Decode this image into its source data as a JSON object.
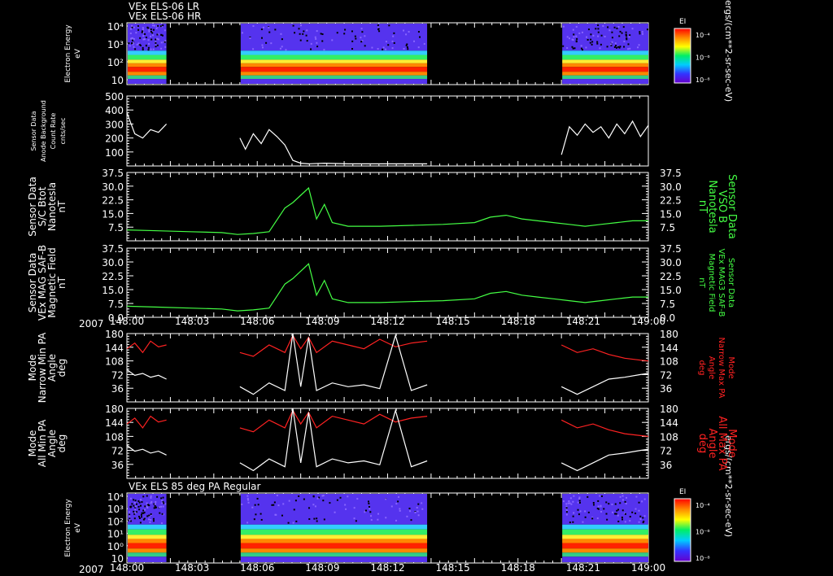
{
  "chart_data": [
    {
      "type": "heatmap",
      "id": "spec1",
      "header_lines": [
        "VEx ELS-06 LR",
        "VEx ELS-06 HR"
      ],
      "ylabel": [
        "Electron Energy",
        "eV"
      ],
      "yticks": [
        "10",
        "10²",
        "10³",
        "10⁴"
      ],
      "colorbar": {
        "label": "EI",
        "ticks": [
          "10⁻⁴",
          "10⁻⁶",
          "10⁻⁸"
        ],
        "units": "ergs/(cm**2-sr-sec-eV)"
      }
    },
    {
      "type": "line",
      "id": "count",
      "ylabel": [
        "Sensor Data",
        "Anode Background",
        "Count Rate",
        "cnts/sec"
      ],
      "yticks": [
        100,
        200,
        300,
        400,
        500
      ],
      "ylim": [
        0,
        500
      ],
      "series": [
        {
          "color": "#ffffff",
          "segments": [
            [
              [
                148.0,
                380
              ],
              [
                148.05,
                230
              ],
              [
                148.1,
                200
              ],
              [
                148.15,
                260
              ],
              [
                148.2,
                240
              ],
              [
                148.25,
                300
              ]
            ],
            [
              [
                148.715,
                200
              ],
              [
                148.75,
                120
              ],
              [
                148.8,
                230
              ],
              [
                148.85,
                160
              ],
              [
                148.9,
                260
              ],
              [
                148.95,
                210
              ],
              [
                149.0,
                150
              ],
              [
                149.05,
                40
              ],
              [
                149.1,
                20
              ],
              [
                149.15,
                15
              ],
              [
                149.25,
                20
              ],
              [
                149.4,
                15
              ],
              [
                149.6,
                15
              ],
              [
                149.8,
                15
              ],
              [
                149.9,
                15
              ]
            ],
            [
              [
                150.75,
                80
              ],
              [
                150.8,
                280
              ],
              [
                150.85,
                220
              ],
              [
                150.9,
                300
              ],
              [
                150.95,
                240
              ],
              [
                151.0,
                280
              ],
              [
                151.05,
                200
              ],
              [
                151.1,
                300
              ],
              [
                151.15,
                230
              ],
              [
                151.2,
                320
              ],
              [
                151.25,
                210
              ],
              [
                151.3,
                290
              ]
            ]
          ]
        }
      ]
    },
    {
      "type": "line",
      "id": "bt",
      "ylabel": [
        "Sensor Data",
        "S/C Btot",
        "Nanotesla",
        "nT"
      ],
      "rlabel": [
        "Sensor Data",
        "VSO B",
        "Nanotesla",
        "nT"
      ],
      "yticks": [
        7.5,
        15.0,
        22.5,
        30.0,
        37.5
      ],
      "ylim": [
        0,
        37.5
      ],
      "series": [
        {
          "color": "#44ff44",
          "points": [
            [
              148.0,
              6
            ],
            [
              148.2,
              5.5
            ],
            [
              148.4,
              5
            ],
            [
              148.6,
              4.5
            ],
            [
              148.7,
              3.5
            ],
            [
              148.8,
              4
            ],
            [
              148.9,
              5
            ],
            [
              149.0,
              18
            ],
            [
              149.05,
              21
            ],
            [
              149.1,
              25
            ],
            [
              149.15,
              29
            ],
            [
              149.2,
              12
            ],
            [
              149.25,
              20
            ],
            [
              149.3,
              10
            ],
            [
              149.4,
              8
            ],
            [
              149.6,
              8
            ],
            [
              149.8,
              8.5
            ],
            [
              150.0,
              9
            ],
            [
              150.2,
              10
            ],
            [
              150.3,
              13
            ],
            [
              150.4,
              14
            ],
            [
              150.5,
              12
            ],
            [
              150.6,
              11
            ],
            [
              150.7,
              10
            ],
            [
              150.8,
              9
            ],
            [
              150.9,
              8
            ],
            [
              151.0,
              9
            ],
            [
              151.1,
              10
            ],
            [
              151.2,
              11
            ],
            [
              151.3,
              11
            ]
          ]
        }
      ]
    },
    {
      "type": "line",
      "id": "bsaf",
      "ylabel": [
        "Sensor Data",
        "VEx MAG SAF-B",
        "Magnetic Field",
        "nT"
      ],
      "rlabel": [
        "Sensor Data",
        "VEx MAG3 SAF-B",
        "Magnetic Field",
        "nT"
      ],
      "yticks": [
        0.0,
        7.5,
        15.0,
        22.5,
        30.0,
        37.5
      ],
      "ylim": [
        0,
        37.5
      ],
      "series": [
        {
          "color": "#44ff44",
          "points": [
            [
              148.0,
              6
            ],
            [
              148.2,
              5.5
            ],
            [
              148.4,
              5
            ],
            [
              148.6,
              4.5
            ],
            [
              148.7,
              3.5
            ],
            [
              148.8,
              4
            ],
            [
              148.9,
              5
            ],
            [
              149.0,
              18
            ],
            [
              149.05,
              21
            ],
            [
              149.1,
              25
            ],
            [
              149.15,
              29
            ],
            [
              149.2,
              12
            ],
            [
              149.25,
              20
            ],
            [
              149.3,
              10
            ],
            [
              149.4,
              8
            ],
            [
              149.6,
              8
            ],
            [
              149.8,
              8.5
            ],
            [
              150.0,
              9
            ],
            [
              150.2,
              10
            ],
            [
              150.3,
              13
            ],
            [
              150.4,
              14
            ],
            [
              150.5,
              12
            ],
            [
              150.6,
              11
            ],
            [
              150.7,
              10
            ],
            [
              150.8,
              9
            ],
            [
              150.9,
              8
            ],
            [
              151.0,
              9
            ],
            [
              151.1,
              10
            ],
            [
              151.2,
              11
            ],
            [
              151.3,
              11
            ]
          ]
        }
      ]
    },
    {
      "type": "line",
      "id": "pa1",
      "ylabel": [
        "Mode",
        "Narrow Min PA",
        "Angle",
        "deg"
      ],
      "rlabel": [
        "Mode",
        "Narrow Max PA",
        "Angle",
        "deg"
      ],
      "yticks": [
        36,
        72,
        108,
        144,
        180
      ],
      "ylim": [
        0,
        180
      ],
      "series": [
        {
          "color": "#ff2222",
          "segments": [
            [
              [
                148.0,
                140
              ],
              [
                148.05,
                155
              ],
              [
                148.1,
                130
              ],
              [
                148.15,
                160
              ],
              [
                148.2,
                145
              ],
              [
                148.25,
                150
              ]
            ],
            [
              [
                148.715,
                130
              ],
              [
                148.8,
                120
              ],
              [
                148.9,
                150
              ],
              [
                149.0,
                130
              ],
              [
                149.05,
                175
              ],
              [
                149.1,
                140
              ],
              [
                149.15,
                170
              ],
              [
                149.2,
                130
              ],
              [
                149.3,
                160
              ],
              [
                149.4,
                150
              ],
              [
                149.5,
                140
              ],
              [
                149.6,
                165
              ],
              [
                149.7,
                145
              ],
              [
                149.8,
                155
              ],
              [
                149.9,
                160
              ]
            ],
            [
              [
                150.75,
                150
              ],
              [
                150.85,
                130
              ],
              [
                150.95,
                140
              ],
              [
                151.05,
                125
              ],
              [
                151.15,
                115
              ],
              [
                151.25,
                110
              ],
              [
                151.3,
                108
              ]
            ]
          ]
        },
        {
          "color": "#ffffff",
          "segments": [
            [
              [
                148.0,
                85
              ],
              [
                148.05,
                70
              ],
              [
                148.1,
                75
              ],
              [
                148.15,
                65
              ],
              [
                148.2,
                70
              ],
              [
                148.25,
                60
              ]
            ],
            [
              [
                148.715,
                40
              ],
              [
                148.8,
                20
              ],
              [
                148.9,
                50
              ],
              [
                149.0,
                30
              ],
              [
                149.05,
                180
              ],
              [
                149.1,
                40
              ],
              [
                149.15,
                170
              ],
              [
                149.2,
                30
              ],
              [
                149.3,
                50
              ],
              [
                149.4,
                40
              ],
              [
                149.5,
                45
              ],
              [
                149.6,
                35
              ],
              [
                149.7,
                175
              ],
              [
                149.8,
                30
              ],
              [
                149.9,
                45
              ]
            ],
            [
              [
                150.75,
                40
              ],
              [
                150.85,
                20
              ],
              [
                150.95,
                40
              ],
              [
                151.05,
                60
              ],
              [
                151.15,
                65
              ],
              [
                151.25,
                72
              ],
              [
                151.3,
                75
              ]
            ]
          ]
        }
      ]
    },
    {
      "type": "line",
      "id": "pa2",
      "ylabel": [
        "Mode",
        "All Min PA",
        "Angle",
        "deg"
      ],
      "rlabel": [
        "Mode",
        "All Max PA",
        "Angle",
        "deg"
      ],
      "yticks": [
        36,
        72,
        108,
        144,
        180
      ],
      "ylim": [
        0,
        180
      ],
      "series": [
        {
          "color": "#ff2222",
          "segments": [
            [
              [
                148.0,
                140
              ],
              [
                148.05,
                155
              ],
              [
                148.1,
                130
              ],
              [
                148.15,
                160
              ],
              [
                148.2,
                145
              ],
              [
                148.25,
                150
              ]
            ],
            [
              [
                148.715,
                130
              ],
              [
                148.8,
                120
              ],
              [
                148.9,
                150
              ],
              [
                149.0,
                130
              ],
              [
                149.05,
                175
              ],
              [
                149.1,
                140
              ],
              [
                149.15,
                170
              ],
              [
                149.2,
                130
              ],
              [
                149.3,
                160
              ],
              [
                149.4,
                150
              ],
              [
                149.5,
                140
              ],
              [
                149.6,
                165
              ],
              [
                149.7,
                145
              ],
              [
                149.8,
                155
              ],
              [
                149.9,
                160
              ]
            ],
            [
              [
                150.75,
                150
              ],
              [
                150.85,
                130
              ],
              [
                150.95,
                140
              ],
              [
                151.05,
                125
              ],
              [
                151.15,
                115
              ],
              [
                151.25,
                110
              ],
              [
                151.3,
                108
              ]
            ]
          ]
        },
        {
          "color": "#ffffff",
          "segments": [
            [
              [
                148.0,
                85
              ],
              [
                148.05,
                70
              ],
              [
                148.1,
                75
              ],
              [
                148.15,
                65
              ],
              [
                148.2,
                70
              ],
              [
                148.25,
                60
              ]
            ],
            [
              [
                148.715,
                40
              ],
              [
                148.8,
                20
              ],
              [
                148.9,
                50
              ],
              [
                149.0,
                30
              ],
              [
                149.05,
                180
              ],
              [
                149.1,
                40
              ],
              [
                149.15,
                170
              ],
              [
                149.2,
                30
              ],
              [
                149.3,
                50
              ],
              [
                149.4,
                40
              ],
              [
                149.5,
                45
              ],
              [
                149.6,
                35
              ],
              [
                149.7,
                175
              ],
              [
                149.8,
                30
              ],
              [
                149.9,
                45
              ]
            ],
            [
              [
                150.75,
                40
              ],
              [
                150.85,
                20
              ],
              [
                150.95,
                40
              ],
              [
                151.05,
                60
              ],
              [
                151.15,
                65
              ],
              [
                151.25,
                72
              ],
              [
                151.3,
                75
              ]
            ]
          ]
        }
      ]
    },
    {
      "type": "heatmap",
      "id": "spec2",
      "header_lines": [
        "VEx ELS 85 deg PA Regular"
      ],
      "ylabel": [
        "Electron Energy",
        "eV"
      ],
      "yticks": [
        "10",
        "10⁰",
        "10¹",
        "10²",
        "10³",
        "10⁴"
      ],
      "colorbar": {
        "label": "EI",
        "ticks": [
          "10⁻⁴",
          "10⁻⁶",
          "10⁻⁸"
        ],
        "units": "ergs/(cm**2-sr-sec-eV)"
      }
    }
  ],
  "time_axis": {
    "year": "2007",
    "ticks": [
      "148:00",
      "148:03",
      "148:06",
      "148:09",
      "148:12",
      "148:15",
      "148:18",
      "148:21",
      "149:00"
    ],
    "range_hours": [
      148.0,
      151.3
    ]
  },
  "data_gaps": [
    [
      148.25,
      148.715
    ],
    [
      149.9,
      150.75
    ]
  ]
}
